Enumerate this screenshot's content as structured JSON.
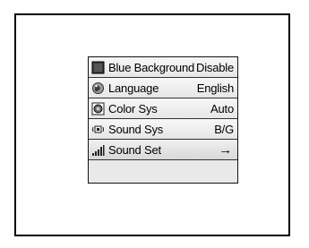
{
  "menu": {
    "items": [
      {
        "label": "Blue Background",
        "value": "Disable",
        "icon": "blue-square-icon"
      },
      {
        "label": "Language",
        "value": "English",
        "icon": "globe-icon"
      },
      {
        "label": "Color Sys",
        "value": "Auto",
        "icon": "color-circle-icon"
      },
      {
        "label": "Sound Sys",
        "value": "B/G",
        "icon": "speaker-icon"
      },
      {
        "label": "Sound Set",
        "value": "→",
        "icon": "volume-bars-icon"
      }
    ]
  }
}
